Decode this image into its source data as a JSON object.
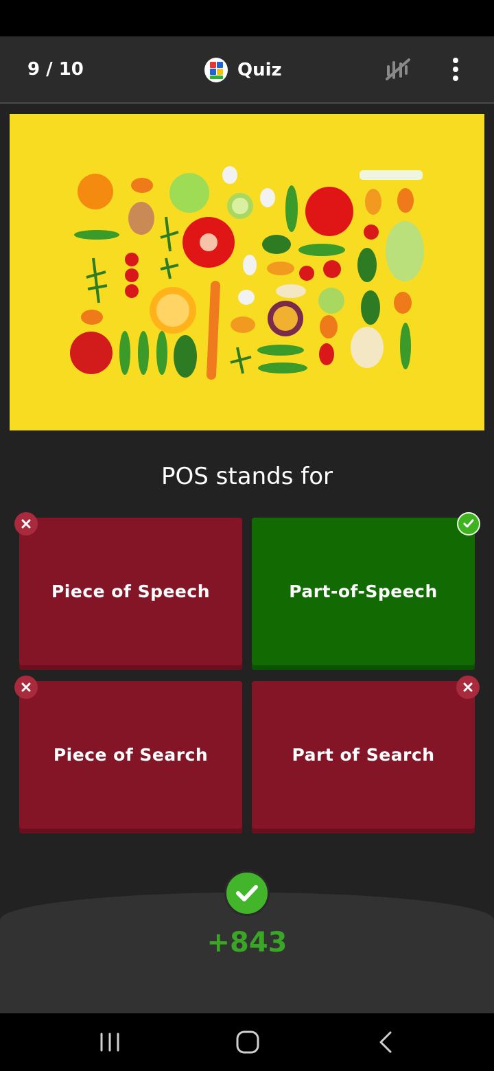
{
  "header": {
    "progress": "9 / 10",
    "title": "Quiz"
  },
  "question": {
    "text": "POS stands for"
  },
  "answers": [
    {
      "label": "Piece of Speech",
      "state": "wrong"
    },
    {
      "label": "Part-of-Speech",
      "state": "correct"
    },
    {
      "label": "Piece of Search",
      "state": "wrong"
    },
    {
      "label": "Part of Search",
      "state": "wrong"
    }
  ],
  "result": {
    "score": "+843"
  },
  "icons": {
    "progress": "progress-text",
    "logo": "quiz-app-logo",
    "slash": "slash-icon",
    "more": "more-vert-icon",
    "correct": "check-icon",
    "wrong": "close-icon"
  },
  "colors": {
    "background": "#222222",
    "wrong_answer": "#841526",
    "correct_answer": "#116b02",
    "score": "#39a626",
    "image_background": "#f8dc22"
  }
}
